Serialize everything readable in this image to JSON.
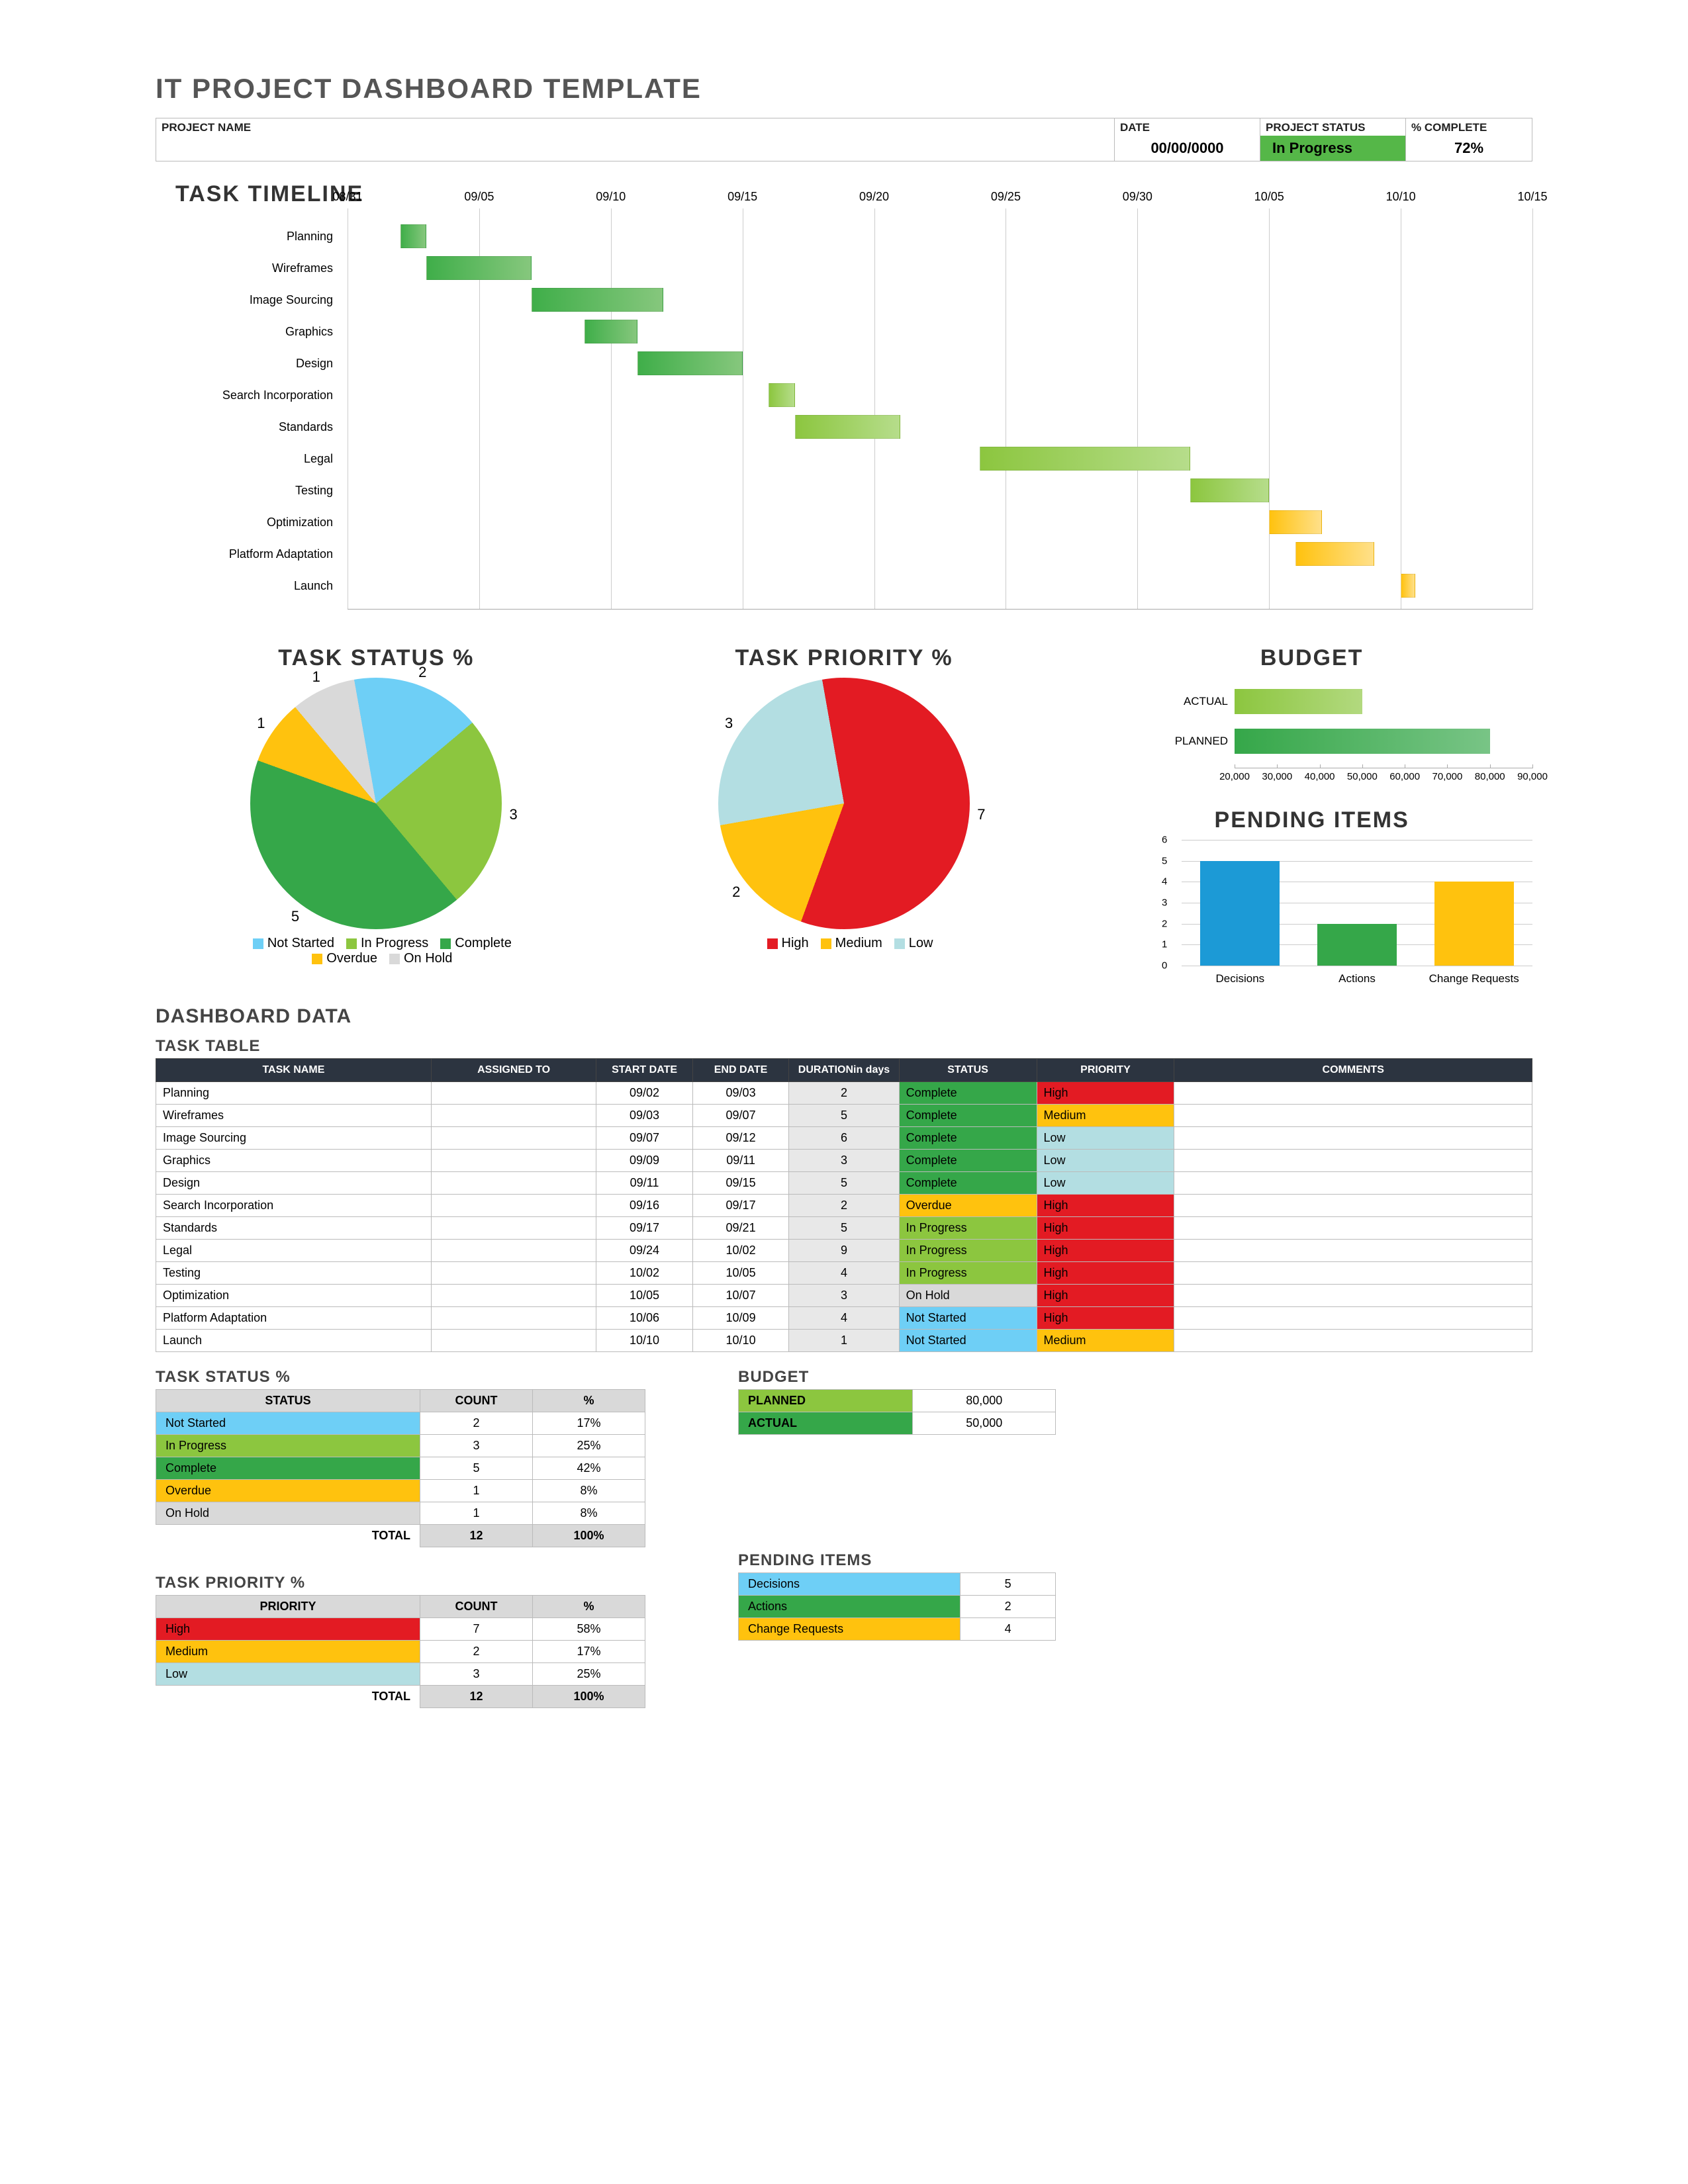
{
  "title": "IT PROJECT DASHBOARD TEMPLATE",
  "header": {
    "project_name_label": "PROJECT NAME",
    "project_name_value": "",
    "date_label": "DATE",
    "date_value": "00/00/0000",
    "status_label": "PROJECT  STATUS",
    "status_value": "In Progress",
    "pct_label": "% COMPLETE",
    "pct_value": "72%"
  },
  "sections": {
    "timeline": "TASK TIMELINE",
    "task_status": "TASK STATUS %",
    "task_priority": "TASK PRIORITY %",
    "budget": "BUDGET",
    "pending": "PENDING ITEMS",
    "dashboard_data": "DASHBOARD DATA",
    "task_table": "TASK TABLE",
    "status_tbl": "TASK STATUS %",
    "priority_tbl": "TASK PRIORITY %",
    "budget_tbl": "BUDGET",
    "pending_tbl": "PENDING ITEMS"
  },
  "chart_data": [
    {
      "type": "gantt",
      "title": "TASK TIMELINE",
      "x_ticks": [
        "08/31",
        "09/05",
        "09/10",
        "09/15",
        "09/20",
        "09/25",
        "09/30",
        "10/05",
        "10/10",
        "10/15"
      ],
      "x_min": "08/31",
      "x_max": "10/15",
      "tasks": [
        {
          "name": "Planning",
          "start": "09/02",
          "end": "09/03",
          "color": "green1"
        },
        {
          "name": "Wireframes",
          "start": "09/03",
          "end": "09/07",
          "color": "green1"
        },
        {
          "name": "Image Sourcing",
          "start": "09/07",
          "end": "09/12",
          "color": "green1"
        },
        {
          "name": "Graphics",
          "start": "09/09",
          "end": "09/11",
          "color": "green1"
        },
        {
          "name": "Design",
          "start": "09/11",
          "end": "09/15",
          "color": "green1"
        },
        {
          "name": "Search Incorporation",
          "start": "09/16",
          "end": "09/17",
          "color": "green2"
        },
        {
          "name": "Standards",
          "start": "09/17",
          "end": "09/21",
          "color": "green2"
        },
        {
          "name": "Legal",
          "start": "09/24",
          "end": "10/02",
          "color": "green2"
        },
        {
          "name": "Testing",
          "start": "10/02",
          "end": "10/05",
          "color": "green2"
        },
        {
          "name": "Optimization",
          "start": "10/05",
          "end": "10/07",
          "color": "yellow"
        },
        {
          "name": "Platform Adaptation",
          "start": "10/06",
          "end": "10/09",
          "color": "yellow"
        },
        {
          "name": "Launch",
          "start": "10/10",
          "end": "10/10",
          "color": "yellow"
        }
      ]
    },
    {
      "type": "pie",
      "title": "TASK STATUS %",
      "series": [
        {
          "name": "Not Started",
          "value": 2,
          "color": "#6ECFF6"
        },
        {
          "name": "In Progress",
          "value": 3,
          "color": "#8CC63F"
        },
        {
          "name": "Complete",
          "value": 5,
          "color": "#35A749"
        },
        {
          "name": "Overdue",
          "value": 1,
          "color": "#FFC20E"
        },
        {
          "name": "On Hold",
          "value": 1,
          "color": "#D9D9D9"
        }
      ]
    },
    {
      "type": "pie",
      "title": "TASK PRIORITY %",
      "series": [
        {
          "name": "High",
          "value": 7,
          "color": "#E31B23"
        },
        {
          "name": "Medium",
          "value": 2,
          "color": "#FFC20E"
        },
        {
          "name": "Low",
          "value": 3,
          "color": "#B3DEE2"
        }
      ]
    },
    {
      "type": "bar",
      "title": "BUDGET",
      "orientation": "horizontal",
      "categories": [
        "ACTUAL",
        "PLANNED"
      ],
      "values": [
        50000,
        80000
      ],
      "xlim": [
        20000,
        90000
      ],
      "x_ticks": [
        20000,
        30000,
        40000,
        50000,
        60000,
        70000,
        80000,
        90000
      ],
      "colors": [
        "#8CC63F",
        "#35A749"
      ]
    },
    {
      "type": "bar",
      "title": "PENDING ITEMS",
      "categories": [
        "Decisions",
        "Actions",
        "Change Requests"
      ],
      "values": [
        5,
        2,
        4
      ],
      "ylim": [
        0,
        6
      ],
      "colors": [
        "#1C9AD6",
        "#35A749",
        "#FFC20E"
      ]
    }
  ],
  "legends": {
    "status": [
      {
        "label": "Not Started",
        "color": "#6ECFF6"
      },
      {
        "label": "In Progress",
        "color": "#8CC63F"
      },
      {
        "label": "Complete",
        "color": "#35A749"
      },
      {
        "label": "Overdue",
        "color": "#FFC20E"
      },
      {
        "label": "On Hold",
        "color": "#D9D9D9"
      }
    ],
    "priority": [
      {
        "label": "High",
        "color": "#E31B23"
      },
      {
        "label": "Medium",
        "color": "#FFC20E"
      },
      {
        "label": "Low",
        "color": "#B3DEE2"
      }
    ]
  },
  "task_table": {
    "headers": [
      "TASK NAME",
      "ASSIGNED TO",
      "START DATE",
      "END DATE",
      "DURATION",
      "STATUS",
      "PRIORITY",
      "COMMENTS"
    ],
    "duration_sub": "in days",
    "rows": [
      {
        "name": "Planning",
        "assigned": "",
        "start": "09/02",
        "end": "09/03",
        "dur": "2",
        "status": "Complete",
        "status_cls": "c-complete",
        "prio": "High",
        "prio_cls": "p-high",
        "comments": ""
      },
      {
        "name": "Wireframes",
        "assigned": "",
        "start": "09/03",
        "end": "09/07",
        "dur": "5",
        "status": "Complete",
        "status_cls": "c-complete",
        "prio": "Medium",
        "prio_cls": "p-med",
        "comments": ""
      },
      {
        "name": "Image Sourcing",
        "assigned": "",
        "start": "09/07",
        "end": "09/12",
        "dur": "6",
        "status": "Complete",
        "status_cls": "c-complete",
        "prio": "Low",
        "prio_cls": "p-low",
        "comments": ""
      },
      {
        "name": "Graphics",
        "assigned": "",
        "start": "09/09",
        "end": "09/11",
        "dur": "3",
        "status": "Complete",
        "status_cls": "c-complete",
        "prio": "Low",
        "prio_cls": "p-low",
        "comments": ""
      },
      {
        "name": "Design",
        "assigned": "",
        "start": "09/11",
        "end": "09/15",
        "dur": "5",
        "status": "Complete",
        "status_cls": "c-complete",
        "prio": "Low",
        "prio_cls": "p-low",
        "comments": ""
      },
      {
        "name": "Search Incorporation",
        "assigned": "",
        "start": "09/16",
        "end": "09/17",
        "dur": "2",
        "status": "Overdue",
        "status_cls": "c-overdue",
        "prio": "High",
        "prio_cls": "p-high",
        "comments": ""
      },
      {
        "name": "Standards",
        "assigned": "",
        "start": "09/17",
        "end": "09/21",
        "dur": "5",
        "status": "In Progress",
        "status_cls": "c-inprog",
        "prio": "High",
        "prio_cls": "p-high",
        "comments": ""
      },
      {
        "name": "Legal",
        "assigned": "",
        "start": "09/24",
        "end": "10/02",
        "dur": "9",
        "status": "In Progress",
        "status_cls": "c-inprog",
        "prio": "High",
        "prio_cls": "p-high",
        "comments": ""
      },
      {
        "name": "Testing",
        "assigned": "",
        "start": "10/02",
        "end": "10/05",
        "dur": "4",
        "status": "In Progress",
        "status_cls": "c-inprog",
        "prio": "High",
        "prio_cls": "p-high",
        "comments": ""
      },
      {
        "name": "Optimization",
        "assigned": "",
        "start": "10/05",
        "end": "10/07",
        "dur": "3",
        "status": "On Hold",
        "status_cls": "c-onhold",
        "prio": "High",
        "prio_cls": "p-high",
        "comments": ""
      },
      {
        "name": "Platform Adaptation",
        "assigned": "",
        "start": "10/06",
        "end": "10/09",
        "dur": "4",
        "status": "Not Started",
        "status_cls": "c-notstart",
        "prio": "High",
        "prio_cls": "p-high",
        "comments": ""
      },
      {
        "name": "Launch",
        "assigned": "",
        "start": "10/10",
        "end": "10/10",
        "dur": "1",
        "status": "Not Started",
        "status_cls": "c-notstart",
        "prio": "Medium",
        "prio_cls": "p-med",
        "comments": ""
      }
    ]
  },
  "status_table": {
    "headers": [
      "STATUS",
      "COUNT",
      "%"
    ],
    "rows": [
      {
        "label": "Not Started",
        "cls": "r-blue",
        "count": "2",
        "pct": "17%"
      },
      {
        "label": "In Progress",
        "cls": "r-lgreen",
        "count": "3",
        "pct": "25%"
      },
      {
        "label": "Complete",
        "cls": "r-green",
        "count": "5",
        "pct": "42%"
      },
      {
        "label": "Overdue",
        "cls": "r-yellow",
        "count": "1",
        "pct": "8%"
      },
      {
        "label": "On Hold",
        "cls": "r-grey",
        "count": "1",
        "pct": "8%"
      }
    ],
    "total_label": "TOTAL",
    "total_count": "12",
    "total_pct": "100%"
  },
  "priority_table": {
    "headers": [
      "PRIORITY",
      "COUNT",
      "%"
    ],
    "rows": [
      {
        "label": "High",
        "cls": "r-red",
        "count": "7",
        "pct": "58%"
      },
      {
        "label": "Medium",
        "cls": "r-yellow",
        "count": "2",
        "pct": "17%"
      },
      {
        "label": "Low",
        "cls": "r-teal",
        "count": "3",
        "pct": "25%"
      }
    ],
    "total_label": "TOTAL",
    "total_count": "12",
    "total_pct": "100%"
  },
  "budget_table": {
    "rows": [
      {
        "label": "PLANNED",
        "cls": "r-lgreen",
        "value": "80,000"
      },
      {
        "label": "ACTUAL",
        "cls": "r-green",
        "value": "50,000"
      }
    ]
  },
  "pending_table": {
    "rows": [
      {
        "label": "Decisions",
        "cls": "r-blue",
        "value": "5"
      },
      {
        "label": "Actions",
        "cls": "r-green",
        "value": "2"
      },
      {
        "label": "Change Requests",
        "cls": "r-yellow",
        "value": "4"
      }
    ]
  }
}
